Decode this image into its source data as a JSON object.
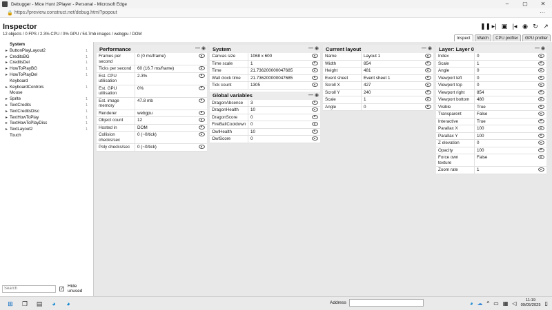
{
  "window": {
    "title": "Debugger - Mice Hunt 2Player - Personal - Microsoft Edge",
    "url": "https://preview.construct.net/debug.html?popout"
  },
  "inspector": {
    "title": "Inspector",
    "status": "12 objects / 0 FPS / 2.3% CPU / 0% GPU / 54.7mb images / webgpu / DOM",
    "tabs": [
      "Inspect",
      "Watch",
      "CPU profiler",
      "GPU profiler"
    ]
  },
  "tree": {
    "items": [
      {
        "label": "System",
        "count": "",
        "expandable": false,
        "bold": true
      },
      {
        "label": "ButtonPlayLayout2",
        "count": "1",
        "expandable": true,
        "bold": false
      },
      {
        "label": "CreditsBG",
        "count": "1",
        "expandable": true,
        "bold": false
      },
      {
        "label": "CreditsDel",
        "count": "1",
        "expandable": true,
        "bold": false
      },
      {
        "label": "HowToPlayBG",
        "count": "1",
        "expandable": true,
        "bold": false
      },
      {
        "label": "HowToPlayDel",
        "count": "1",
        "expandable": true,
        "bold": false
      },
      {
        "label": "Keyboard",
        "count": "",
        "expandable": false,
        "bold": false
      },
      {
        "label": "KeyboardControls",
        "count": "1",
        "expandable": true,
        "bold": false
      },
      {
        "label": "Mouse",
        "count": "",
        "expandable": false,
        "bold": false
      },
      {
        "label": "Sprite",
        "count": "1",
        "expandable": true,
        "bold": false
      },
      {
        "label": "TextCredits",
        "count": "1",
        "expandable": true,
        "bold": false
      },
      {
        "label": "TextCreditsDisc",
        "count": "1",
        "expandable": true,
        "bold": false
      },
      {
        "label": "TextHowToPlay",
        "count": "1",
        "expandable": true,
        "bold": false
      },
      {
        "label": "TextHowToPlayDisc",
        "count": "1",
        "expandable": true,
        "bold": false
      },
      {
        "label": "TextLayout2",
        "count": "1",
        "expandable": true,
        "bold": false
      },
      {
        "label": "Touch",
        "count": "",
        "expandable": false,
        "bold": false
      }
    ],
    "search_placeholder": "Search",
    "hide_unused_label": "Hide unused"
  },
  "performance": {
    "title": "Performance",
    "rows": [
      {
        "k": "Frames per second",
        "v": "0 (0 ms/frame)"
      },
      {
        "k": "Ticks per second",
        "v": "60 (16.7 ms/frame)"
      },
      {
        "k": "Est. CPU utilisation",
        "v": "2.3%"
      },
      {
        "k": "Est. GPU utilisation",
        "v": "0%"
      },
      {
        "k": "Est. image memory",
        "v": "47.8 mb"
      },
      {
        "k": "Renderer",
        "v": "webgpu"
      },
      {
        "k": "Object count",
        "v": "12"
      },
      {
        "k": "Hosted in",
        "v": "DOM"
      },
      {
        "k": "Collision checks/sec",
        "v": "0 (~0/tick)"
      },
      {
        "k": "Poly checks/sec",
        "v": "0 (~0/tick)"
      }
    ]
  },
  "system": {
    "title": "System",
    "rows": [
      {
        "k": "Canvas size",
        "v": "1068 x 600"
      },
      {
        "k": "Time scale",
        "v": "1"
      },
      {
        "k": "Time",
        "v": "21.736200000047685"
      },
      {
        "k": "Wall clock time",
        "v": "21.736200000047685"
      },
      {
        "k": "Tick count",
        "v": "1305"
      }
    ],
    "globals_title": "Global variables",
    "globals": [
      {
        "k": "DragonAbsence",
        "v": "3"
      },
      {
        "k": "DragonHealth",
        "v": "10"
      },
      {
        "k": "DragonScore",
        "v": "0"
      },
      {
        "k": "FireBallCooldown",
        "v": "0"
      },
      {
        "k": "OwlHealth",
        "v": "10"
      },
      {
        "k": "OwlScore",
        "v": "0"
      }
    ]
  },
  "layout": {
    "title": "Current layout",
    "rows": [
      {
        "k": "Name",
        "v": "Layout 1"
      },
      {
        "k": "Width",
        "v": "854"
      },
      {
        "k": "Height",
        "v": "481"
      },
      {
        "k": "Event sheet",
        "v": "Event sheet 1"
      },
      {
        "k": "Scroll X",
        "v": "427"
      },
      {
        "k": "Scroll Y",
        "v": "240"
      },
      {
        "k": "Scale",
        "v": "1"
      },
      {
        "k": "Angle",
        "v": "0"
      }
    ]
  },
  "layer": {
    "title": "Layer: Layer 0",
    "rows": [
      {
        "k": "Index",
        "v": "0"
      },
      {
        "k": "Scale",
        "v": "1"
      },
      {
        "k": "Angle",
        "v": "0"
      },
      {
        "k": "Viewport left",
        "v": "0"
      },
      {
        "k": "Viewport top",
        "v": "0"
      },
      {
        "k": "Viewport right",
        "v": "854"
      },
      {
        "k": "Viewport bottom",
        "v": "480"
      },
      {
        "k": "Visible",
        "v": "True"
      },
      {
        "k": "Transparent",
        "v": "False"
      },
      {
        "k": "Interactive",
        "v": "True"
      },
      {
        "k": "Parallax X",
        "v": "100"
      },
      {
        "k": "Parallax Y",
        "v": "100"
      },
      {
        "k": "Z elevation",
        "v": "0"
      },
      {
        "k": "Opacity",
        "v": "100"
      },
      {
        "k": "Force own texture",
        "v": "False"
      },
      {
        "k": "Zoom rate",
        "v": "1"
      }
    ]
  },
  "taskbar": {
    "address_label": "Address",
    "time": "11:19",
    "date": "09/05/2025"
  }
}
